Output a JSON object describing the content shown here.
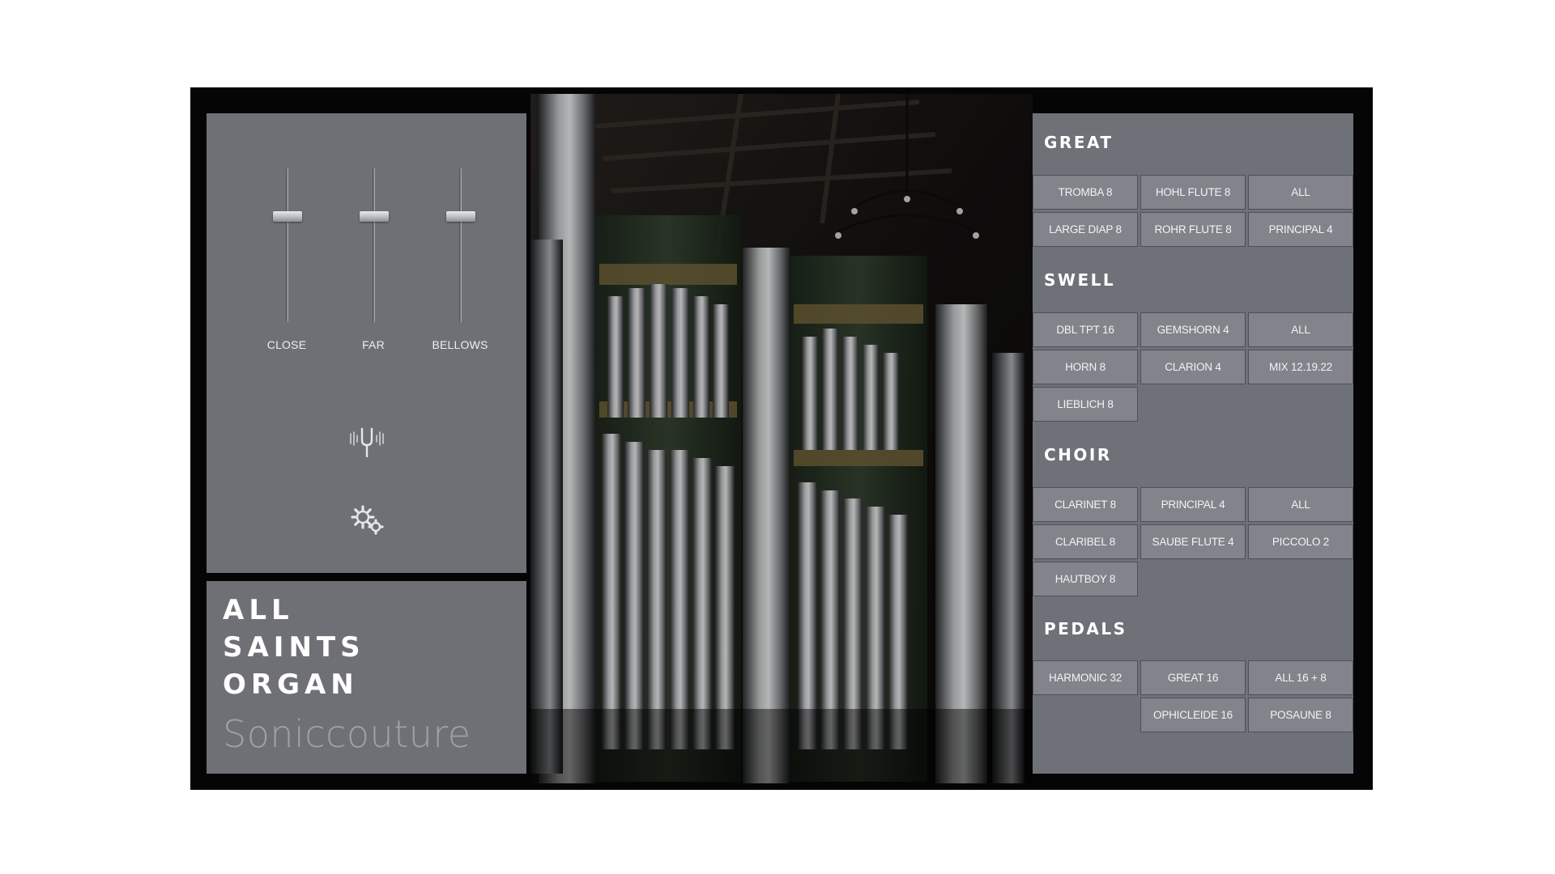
{
  "mixer": {
    "faders": [
      {
        "label": "CLOSE",
        "level": 0.7
      },
      {
        "label": "FAR",
        "level": 0.7
      },
      {
        "label": "BELLOWS",
        "level": 0.7
      }
    ],
    "icons": [
      "tuning-fork-icon",
      "settings-gears-icon"
    ]
  },
  "title": {
    "lines": [
      "ALL",
      "SAINTS",
      "ORGAN"
    ],
    "brand": "Soniccouture"
  },
  "stops": {
    "great": {
      "header": "GREAT",
      "buttons": [
        "TROMBA 8",
        "HOHL FLUTE 8",
        "ALL",
        "LARGE DIAP 8",
        "ROHR FLUTE 8",
        "PRINCIPAL 4"
      ]
    },
    "swell": {
      "header": "SWELL",
      "buttons": [
        "DBL TPT 16",
        "GEMSHORN 4",
        "ALL",
        "HORN 8",
        "CLARION 4",
        "MIX 12.19.22",
        "LIEBLICH 8"
      ]
    },
    "choir": {
      "header": "CHOIR",
      "buttons": [
        "CLARINET 8",
        "PRINCIPAL 4",
        "ALL",
        "CLARIBEL 8",
        "SAUBE FLUTE 4",
        "PICCOLO 2",
        "HAUTBOY 8"
      ]
    },
    "pedals": {
      "header": "PEDALS",
      "buttons": [
        "HARMONIC 32",
        "GREAT 16",
        "ALL 16 + 8",
        "OPHICLEIDE 16",
        "POSAUNE 8"
      ]
    }
  },
  "colors": {
    "panel": "#76787f",
    "frame": "#050505",
    "stop_border": "#4e5057",
    "text": "#ffffff"
  }
}
